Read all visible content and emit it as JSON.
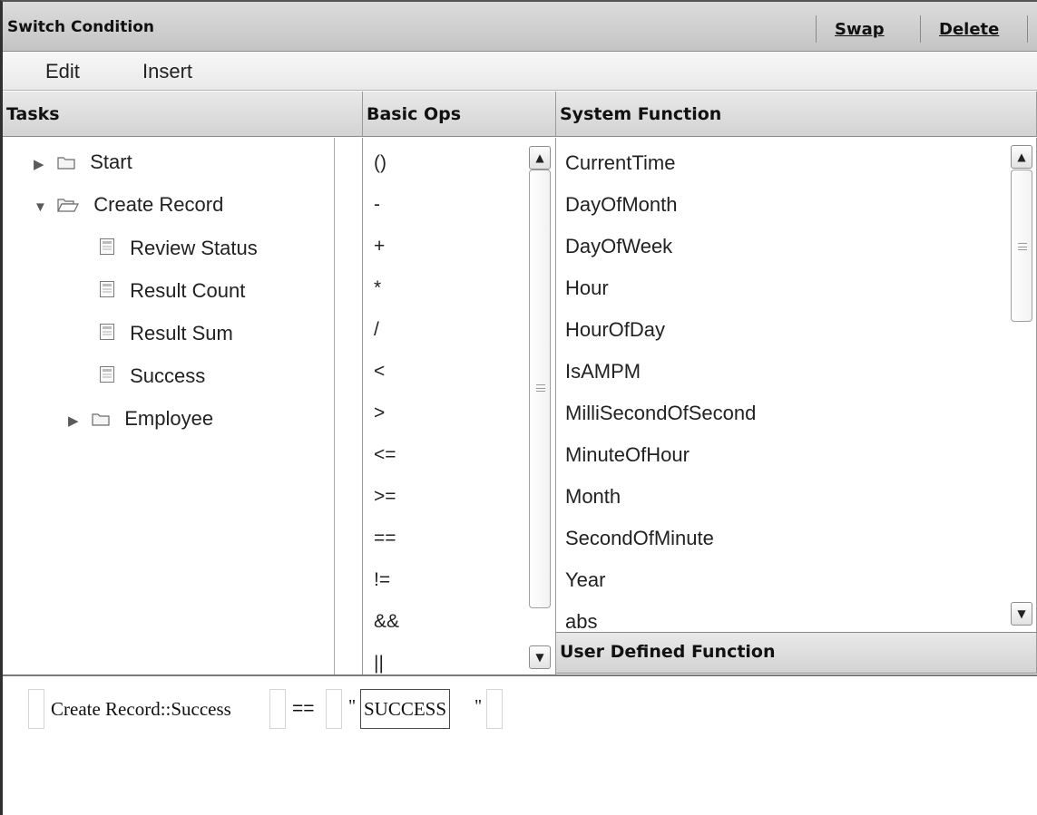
{
  "window": {
    "title": "Switch Condition",
    "actions": {
      "swap": "Swap",
      "delete": "Delete"
    }
  },
  "menu": {
    "edit": "Edit",
    "insert": "Insert"
  },
  "tasks": {
    "header": "Tasks",
    "items": [
      {
        "label": "Start",
        "type": "folder",
        "expanded": false
      },
      {
        "label": "Create Record",
        "type": "folder",
        "expanded": true
      },
      {
        "label": "Review Status",
        "type": "field"
      },
      {
        "label": "Result Count",
        "type": "field"
      },
      {
        "label": "Result Sum",
        "type": "field"
      },
      {
        "label": "Success",
        "type": "field"
      },
      {
        "label": "Employee",
        "type": "folder",
        "expanded": false
      }
    ]
  },
  "basic_ops": {
    "header": "Basic Ops",
    "items": [
      "()",
      "-",
      "+",
      "*",
      "/",
      "<",
      ">",
      "<=",
      ">=",
      "==",
      "!=",
      "&&",
      "||"
    ]
  },
  "system_function": {
    "header": "System Function",
    "items": [
      "CurrentTime",
      "DayOfMonth",
      "DayOfWeek",
      "Hour",
      "HourOfDay",
      "IsAMPM",
      "MilliSecondOfSecond",
      "MinuteOfHour",
      "Month",
      "SecondOfMinute",
      "Year",
      "abs"
    ]
  },
  "user_defined": {
    "header": "User Defined Function"
  },
  "expression": {
    "operand": "Create Record::Success",
    "operator": "==",
    "open_quote": "\"",
    "value": "SUCCESS",
    "close_quote": "\""
  },
  "colors": {
    "header_bg": "#d9d9d9",
    "border": "#8a8a8a"
  }
}
